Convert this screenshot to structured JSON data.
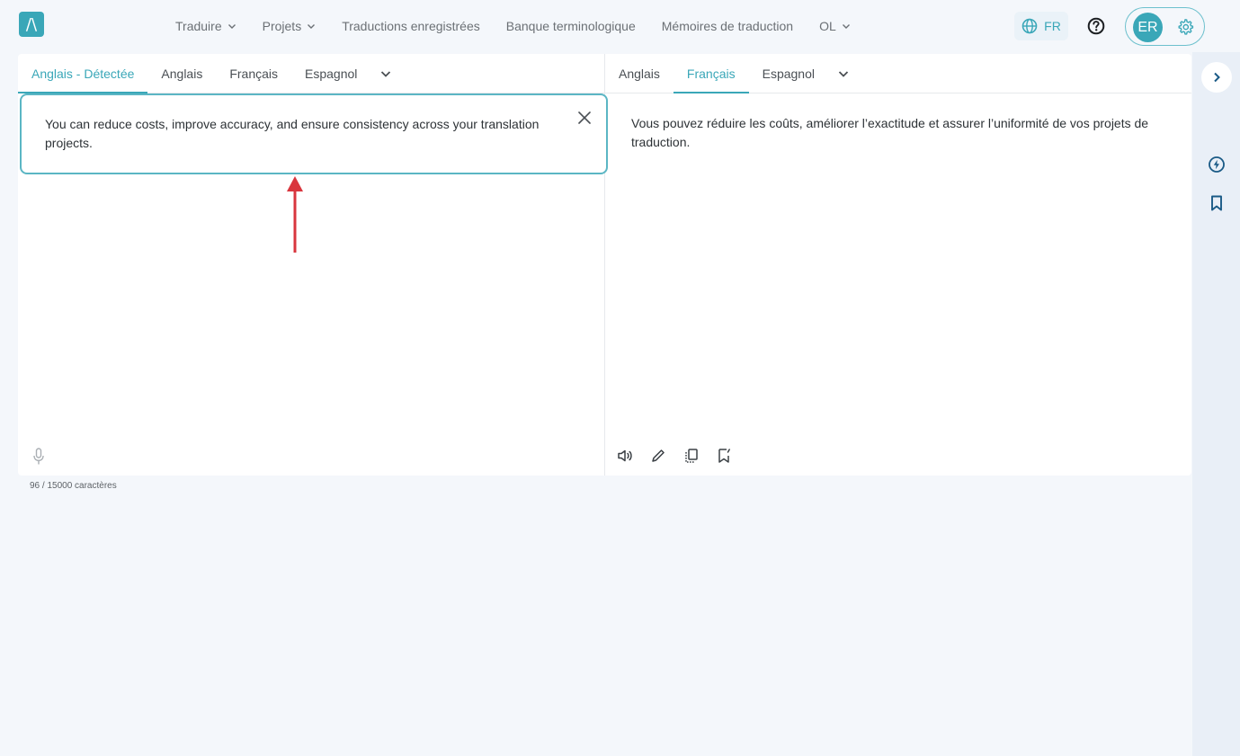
{
  "header": {
    "logo_glyph": "/\\",
    "nav": [
      {
        "label": "Traduire",
        "has_dropdown": true
      },
      {
        "label": "Projets",
        "has_dropdown": true
      },
      {
        "label": "Traductions enregistrées",
        "has_dropdown": false
      },
      {
        "label": "Banque terminologique",
        "has_dropdown": false
      },
      {
        "label": "Mémoires de traduction",
        "has_dropdown": false
      },
      {
        "label": "OL",
        "has_dropdown": true
      }
    ],
    "ui_language": "FR",
    "user_initials": "ER"
  },
  "source": {
    "tabs": [
      "Anglais - Détectée",
      "Anglais",
      "Français",
      "Espagnol"
    ],
    "active_tab": 0,
    "text": "You can reduce costs, improve accuracy, and ensure consistency across your translation projects.",
    "char_count": "96 / 15000 caractères"
  },
  "target": {
    "tabs": [
      "Anglais",
      "Français",
      "Espagnol"
    ],
    "active_tab": 1,
    "text": "Vous pouvez réduire les coûts, améliorer l’exactitude et assurer l’uniformité de vos projets de traduction."
  },
  "colors": {
    "accent": "#3aa7b8",
    "annotation_arrow": "#d9363e",
    "background": "#f4f7fb"
  },
  "icons": {
    "rail": [
      "chevron-right-icon",
      "lightning-icon",
      "bookmark-icon"
    ],
    "target_tools": [
      "speaker-icon",
      "pencil-icon",
      "copy-icon",
      "bookmark-check-icon"
    ]
  }
}
